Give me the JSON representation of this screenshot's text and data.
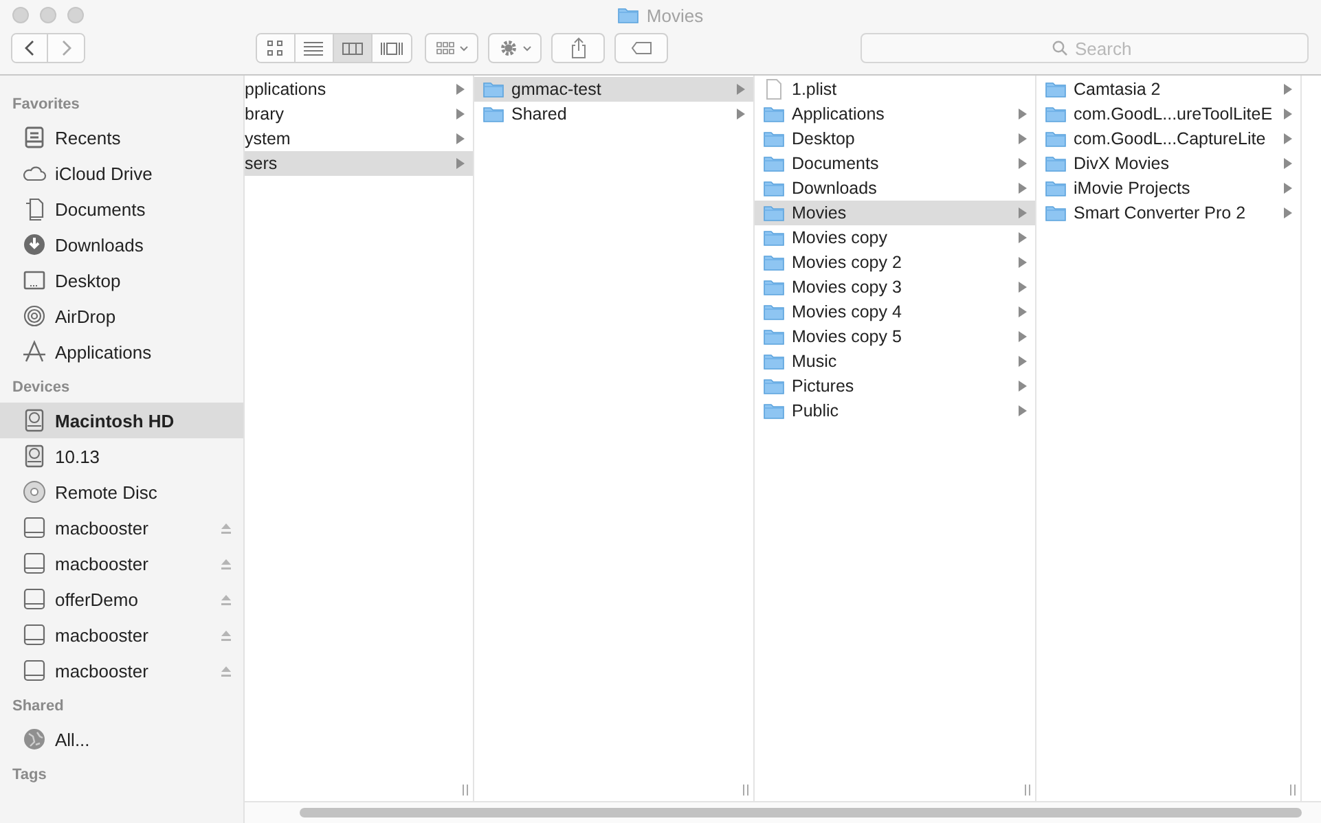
{
  "window": {
    "title": "Movies"
  },
  "toolbar": {
    "views": [
      {
        "kind": "icons",
        "selected": false
      },
      {
        "kind": "list",
        "selected": false
      },
      {
        "kind": "columns",
        "selected": true
      },
      {
        "kind": "coverflow",
        "selected": false
      }
    ],
    "search": {
      "placeholder": "Search"
    }
  },
  "sidebar": {
    "sections": [
      {
        "title": "Favorites",
        "items": [
          {
            "label": "Recents",
            "kind": "recents",
            "selected": false,
            "ejectable": false
          },
          {
            "label": "iCloud Drive",
            "kind": "cloud",
            "selected": false,
            "ejectable": false
          },
          {
            "label": "Documents",
            "kind": "documents",
            "selected": false,
            "ejectable": false
          },
          {
            "label": "Downloads",
            "kind": "downloads",
            "selected": false,
            "ejectable": false
          },
          {
            "label": "Desktop",
            "kind": "desktop",
            "selected": false,
            "ejectable": false
          },
          {
            "label": "AirDrop",
            "kind": "airdrop",
            "selected": false,
            "ejectable": false
          },
          {
            "label": "Applications",
            "kind": "applications",
            "selected": false,
            "ejectable": false
          }
        ]
      },
      {
        "title": "Devices",
        "items": [
          {
            "label": "Macintosh HD",
            "kind": "disk",
            "selected": true,
            "ejectable": false
          },
          {
            "label": "10.13",
            "kind": "disk",
            "selected": false,
            "ejectable": false
          },
          {
            "label": "Remote Disc",
            "kind": "disc",
            "selected": false,
            "ejectable": false
          },
          {
            "label": "macbooster",
            "kind": "volume",
            "selected": false,
            "ejectable": true
          },
          {
            "label": "macbooster",
            "kind": "volume",
            "selected": false,
            "ejectable": true
          },
          {
            "label": "offerDemo",
            "kind": "volume",
            "selected": false,
            "ejectable": true
          },
          {
            "label": "macbooster",
            "kind": "volume",
            "selected": false,
            "ejectable": true
          },
          {
            "label": "macbooster",
            "kind": "volume",
            "selected": false,
            "ejectable": true
          }
        ]
      },
      {
        "title": "Shared",
        "items": [
          {
            "label": "All...",
            "kind": "network",
            "selected": false,
            "ejectable": false
          }
        ]
      },
      {
        "title": "Tags"
      }
    ]
  },
  "columns": [
    {
      "items": [
        {
          "name": "pplications",
          "kind": "clipped",
          "selected": false
        },
        {
          "name": "brary",
          "kind": "clipped",
          "selected": false
        },
        {
          "name": "ystem",
          "kind": "clipped",
          "selected": false
        },
        {
          "name": "sers",
          "kind": "clipped",
          "selected": true
        }
      ]
    },
    {
      "items": [
        {
          "name": "gmmac-test",
          "kind": "folder",
          "selected": true
        },
        {
          "name": "Shared",
          "kind": "folder",
          "selected": false
        }
      ]
    },
    {
      "items": [
        {
          "name": "1.plist",
          "kind": "file",
          "selected": false
        },
        {
          "name": "Applications",
          "kind": "folder",
          "selected": false
        },
        {
          "name": "Desktop",
          "kind": "folder",
          "selected": false
        },
        {
          "name": "Documents",
          "kind": "folder",
          "selected": false
        },
        {
          "name": "Downloads",
          "kind": "folder",
          "selected": false
        },
        {
          "name": "Movies",
          "kind": "folder",
          "selected": true
        },
        {
          "name": "Movies copy",
          "kind": "folder",
          "selected": false
        },
        {
          "name": "Movies copy 2",
          "kind": "folder",
          "selected": false
        },
        {
          "name": "Movies copy 3",
          "kind": "folder",
          "selected": false
        },
        {
          "name": "Movies copy 4",
          "kind": "folder",
          "selected": false
        },
        {
          "name": "Movies copy 5",
          "kind": "folder",
          "selected": false
        },
        {
          "name": "Music",
          "kind": "folder",
          "selected": false
        },
        {
          "name": "Pictures",
          "kind": "folder",
          "selected": false
        },
        {
          "name": "Public",
          "kind": "folder",
          "selected": false
        }
      ]
    },
    {
      "items": [
        {
          "name": "Camtasia 2",
          "kind": "folder",
          "selected": false
        },
        {
          "name": "com.GoodL...ureToolLiteE",
          "kind": "folder",
          "selected": false
        },
        {
          "name": "com.GoodL...CaptureLite",
          "kind": "folder",
          "selected": false
        },
        {
          "name": "DivX Movies",
          "kind": "folder",
          "selected": false
        },
        {
          "name": "iMovie Projects",
          "kind": "folder",
          "selected": false
        },
        {
          "name": "Smart Converter Pro 2",
          "kind": "folder",
          "selected": false
        }
      ]
    }
  ]
}
